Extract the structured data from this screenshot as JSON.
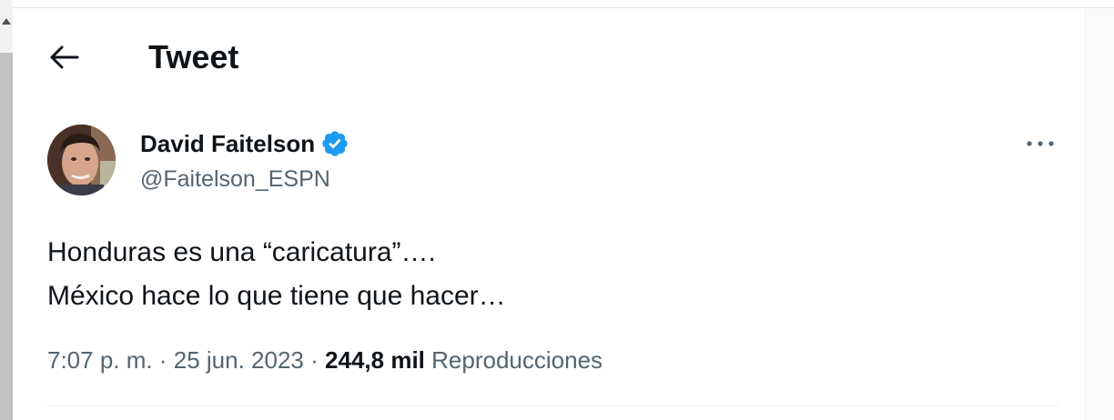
{
  "header": {
    "title": "Tweet",
    "back_icon": "arrow-left-icon"
  },
  "author": {
    "name": "David Faitelson",
    "handle": "@Faitelson_ESPN",
    "verified_icon": "verified-badge-icon",
    "verified_color": "#1d9bf0"
  },
  "tweet": {
    "lines": [
      "Honduras es una “caricatura”….",
      "México hace lo que tiene que hacer…"
    ],
    "time": "7:07 p. m.",
    "separator": "·",
    "date": "25 jun. 2023",
    "views_count": "244,8 mil",
    "views_label": "Reproducciones"
  },
  "more_icon": "more-horizontal-icon",
  "colors": {
    "primary_text": "#0f1419",
    "secondary_text": "#536471",
    "accent": "#1d9bf0"
  }
}
